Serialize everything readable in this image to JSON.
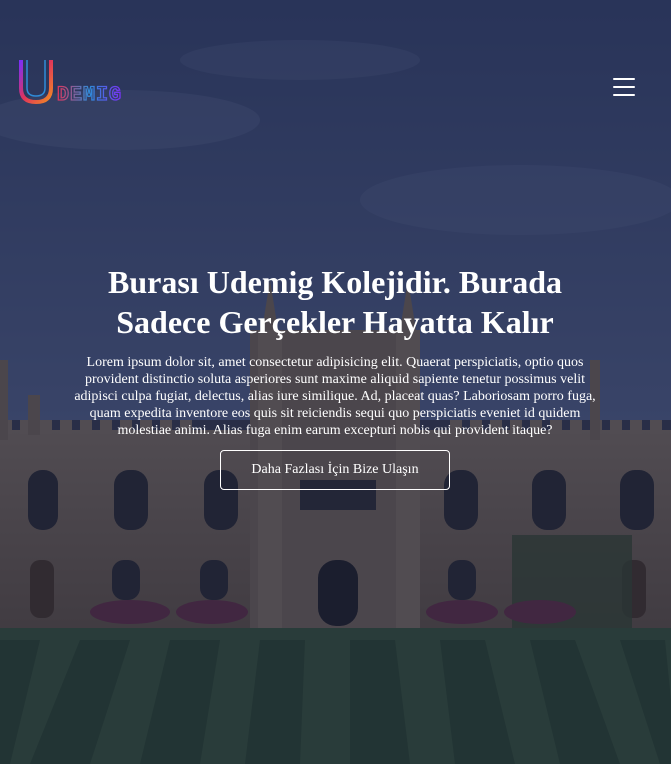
{
  "logo": {
    "text": "UDEMIG",
    "colors": [
      "#7b2ff7",
      "#e0345b",
      "#f08a24",
      "#2f8bd8"
    ]
  },
  "menu": {
    "icon": "hamburger-icon"
  },
  "hero": {
    "title": "Burası Udemig Kolejidir. Burada Sadece Gerçekler Hayatta Kalır",
    "description": "Lorem ipsum dolor sit, amet consectetur adipisicing elit. Quaerat perspiciatis, optio quos provident distinctio soluta asperiores sunt maxime aliquid sapiente tenetur possimus velit adipisci culpa fugiat, delectus, alias iure similique. Ad, placeat quas? Laboriosam porro fuga, quam expedita inventore eos quis sit reiciendis sequi quo perspiciatis eveniet id quidem molestiae animi. Alias fuga enim earum excepturi nobis qui provident itaque?",
    "cta_label": "Daha Fazlası İçin Bize Ulaşın"
  }
}
